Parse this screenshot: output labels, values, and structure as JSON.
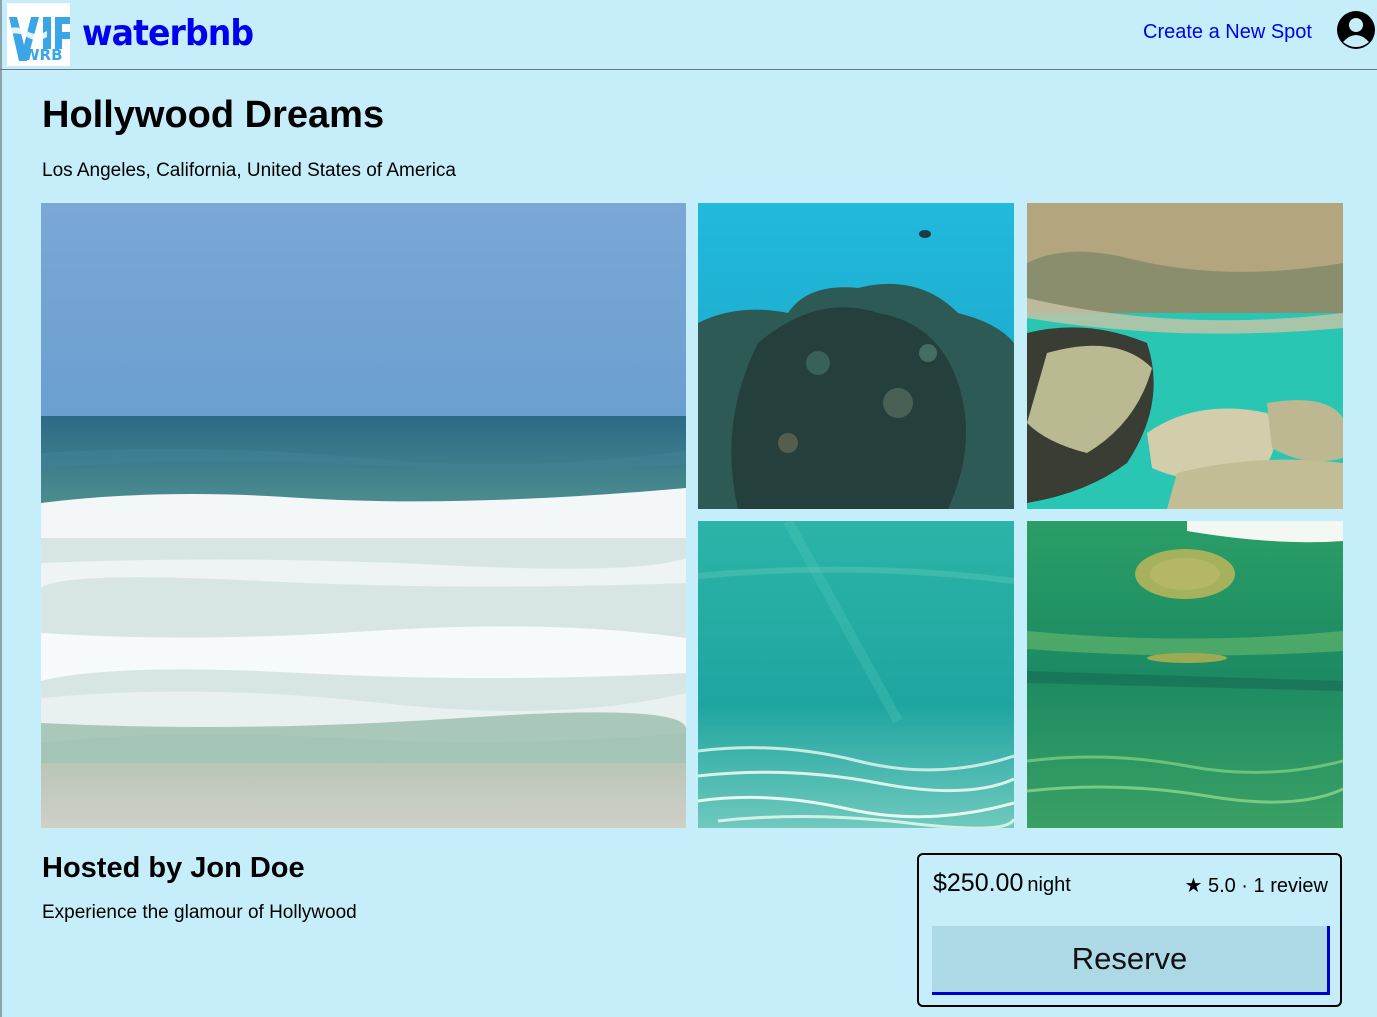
{
  "header": {
    "logo_text": "WRB",
    "brand": "waterbnb",
    "create_spot_link": "Create a New Spot",
    "profile_icon": "user-circle-icon"
  },
  "spot": {
    "name": "Hollywood Dreams",
    "location": "Los Angeles, California, United States of America",
    "host": "Hosted by Jon Doe",
    "description": "Experience the glamour of Hollywood"
  },
  "gallery": {
    "images": [
      {
        "subject": "ocean waves breaking on beach"
      },
      {
        "subject": "underwater coral reef"
      },
      {
        "subject": "underwater rocks with fish"
      },
      {
        "subject": "clear turquoise underwater sand"
      },
      {
        "subject": "green underwater view"
      }
    ]
  },
  "booking": {
    "price": "$250.00",
    "per_night": "night",
    "rating": "★ 5.0 · 1 review",
    "reserve_label": "Reserve"
  },
  "colors": {
    "background": "#c6eefa",
    "link": "#0000ee",
    "reserve_button": "#add8e6"
  }
}
